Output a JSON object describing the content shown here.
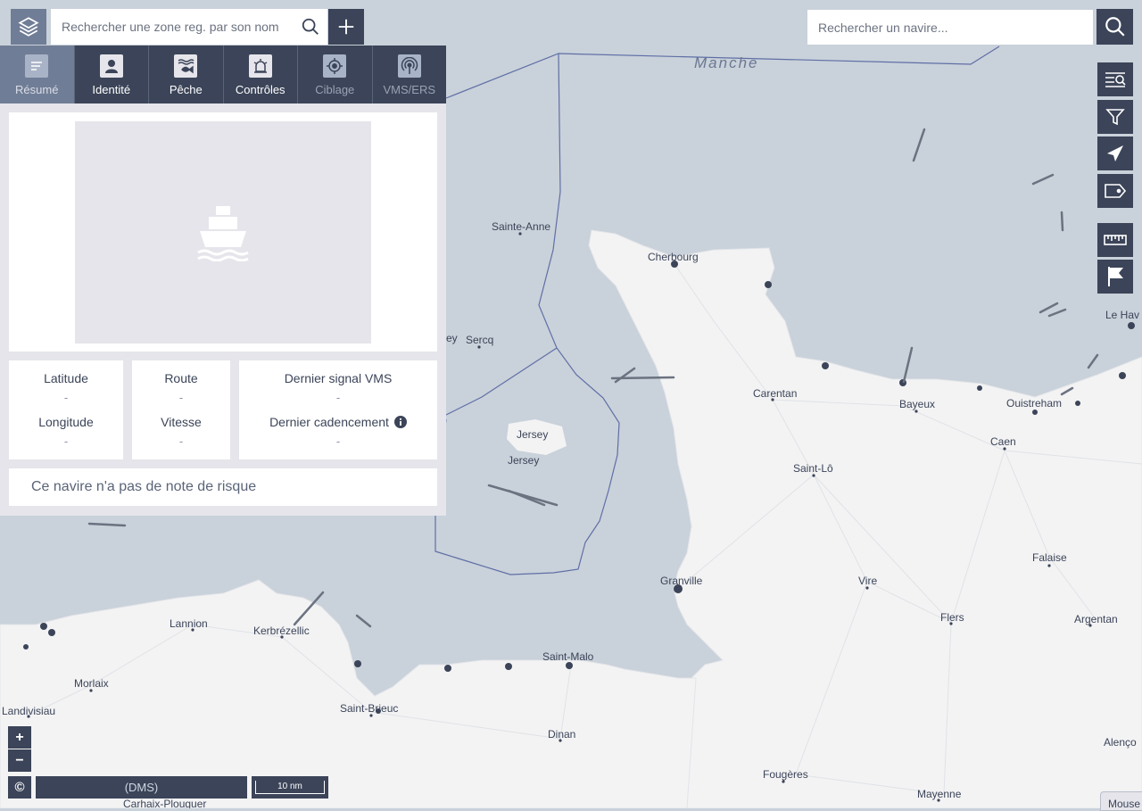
{
  "zone_search": {
    "placeholder": "Rechercher une zone reg. par son nom"
  },
  "vessel_search": {
    "placeholder": "Rechercher un navire..."
  },
  "tabs": [
    {
      "label": "Résumé",
      "icon": "summary-icon"
    },
    {
      "label": "Identité",
      "icon": "identity-icon"
    },
    {
      "label": "Pêche",
      "icon": "fishing-icon"
    },
    {
      "label": "Contrôles",
      "icon": "controls-icon"
    },
    {
      "label": "Ciblage",
      "icon": "target-icon"
    },
    {
      "label": "VMS/ERS",
      "icon": "vms-icon"
    }
  ],
  "position": {
    "latitude_label": "Latitude",
    "latitude_value": "-",
    "longitude_label": "Longitude",
    "longitude_value": "-",
    "route_label": "Route",
    "route_value": "-",
    "speed_label": "Vitesse",
    "speed_value": "-",
    "last_vms_label": "Dernier signal VMS",
    "last_vms_value": "-",
    "cadence_label": "Dernier cadencement",
    "cadence_value": "-"
  },
  "risk_note": "Ce navire n'a pas de note de risque",
  "map": {
    "sea_label": "Manche",
    "places": {
      "sainte_anne": "Sainte-Anne",
      "cherbourg": "Cherbourg",
      "sercq": "Sercq",
      "ey": "ey",
      "jersey_island": "Jersey",
      "jersey_town": "Jersey",
      "carentan": "Carentan",
      "bayeux": "Bayeux",
      "ouistreham": "Ouistreham",
      "le_havre": "Le Hav",
      "caen": "Caen",
      "saint_lo": "Saint-Lô",
      "falaise": "Falaise",
      "granville": "Granville",
      "vire": "Vire",
      "flers": "Flers",
      "argentan": "Argentan",
      "lannion": "Lannion",
      "kerbrezellic": "Kerbrézellic",
      "morlaix": "Morlaix",
      "saint_malo": "Saint-Malo",
      "landivisiau": "Landivisiau",
      "saint_brieuc": "Saint-Brieuc",
      "dinan": "Dinan",
      "fougeres": "Fougères",
      "mayenne": "Mayenne",
      "alencon": "Alenço",
      "carhaix": "Carhaix-Plouguer"
    }
  },
  "controls": {
    "zoom_in": "+",
    "zoom_out": "−",
    "attribution": "©",
    "coordinates_format": "(DMS)",
    "scale": "10 nm",
    "mouse_position": "Mouse"
  }
}
